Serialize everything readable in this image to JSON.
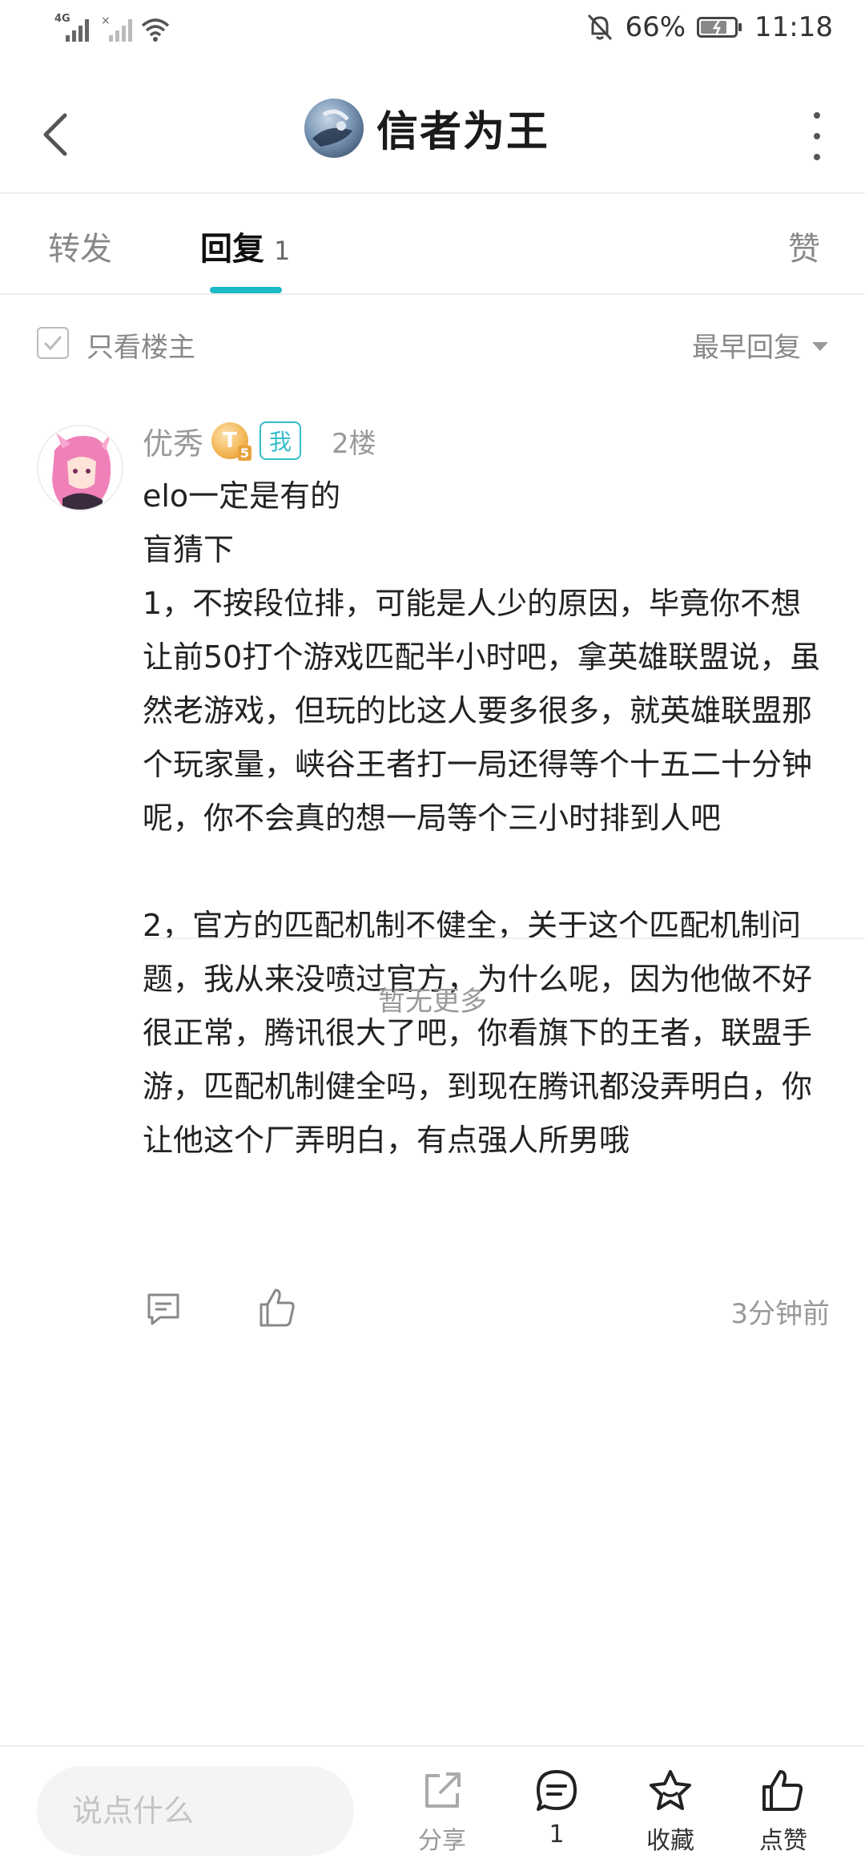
{
  "status_bar": {
    "network_label": "4G",
    "battery_percent": "66%",
    "time": "11:18"
  },
  "header": {
    "title": "信者为王"
  },
  "tabs": {
    "forward": "转发",
    "reply": "回复",
    "reply_count": "1",
    "like": "赞"
  },
  "filter": {
    "only_op_label": "只看楼主",
    "sort_label": "最早回复"
  },
  "post": {
    "username": "优秀",
    "level_badge": "T",
    "level_sub": "5",
    "me_badge": "我",
    "floor": "2楼",
    "content": "elo一定是有的\n盲猜下\n1，不按段位排，可能是人少的原因，毕竟你不想让前50打个游戏匹配半小时吧，拿英雄联盟说，虽然老游戏，但玩的比这人要多很多，就英雄联盟那个玩家量，峡谷王者打一局还得等个十五二十分钟呢，你不会真的想一局等个三小时排到人吧\n\n2，官方的匹配机制不健全，关于这个匹配机制问题，我从来没喷过官方，为什么呢，因为他做不好很正常，腾讯很大了吧，你看旗下的王者，联盟手游，匹配机制健全吗，到现在腾讯都没弄明白，你让他这个厂弄明白，有点强人所男哦",
    "time": "3分钟前"
  },
  "no_more": "暂无更多",
  "bottom_bar": {
    "input_placeholder": "说点什么",
    "share_label": "分享",
    "comment_count": "1",
    "favorite_label": "收藏",
    "like_label": "点赞"
  },
  "colors": {
    "accent": "#1cbac8",
    "badge_border": "#35bdca",
    "muted_text": "#999999"
  }
}
